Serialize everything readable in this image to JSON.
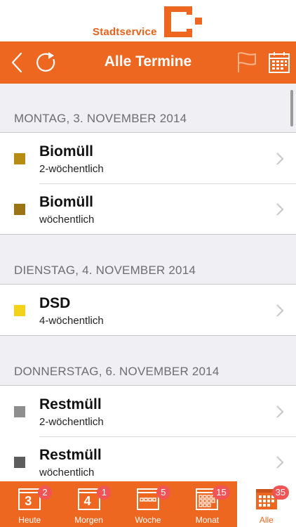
{
  "brand": {
    "name": "Stadtservice"
  },
  "nav": {
    "title": "Alle Termine",
    "icons": [
      "back-icon",
      "refresh-icon",
      "flag-icon",
      "calendar-icon"
    ]
  },
  "sections": [
    {
      "header": "MONTAG, 3. NOVEMBER 2014",
      "items": [
        {
          "title": "Biomüll",
          "subtitle": "2-wöchentlich",
          "color": "#b88c12"
        },
        {
          "title": "Biomüll",
          "subtitle": "wöchentlich",
          "color": "#9b7416"
        }
      ]
    },
    {
      "header": "DIENSTAG, 4. NOVEMBER 2014",
      "items": [
        {
          "title": "DSD",
          "subtitle": "4-wöchentlich",
          "color": "#f4d21a"
        }
      ]
    },
    {
      "header": "DONNERSTAG, 6. NOVEMBER 2014",
      "items": [
        {
          "title": "Restmüll",
          "subtitle": "2-wöchentlich",
          "color": "#8e8e8e"
        },
        {
          "title": "Restmüll",
          "subtitle": "wöchentlich",
          "color": "#5d5d5d"
        }
      ]
    }
  ],
  "tabs": [
    {
      "label": "Heute",
      "icon_number": "3",
      "badge": "2"
    },
    {
      "label": "Morgen",
      "icon_number": "4",
      "badge": "1"
    },
    {
      "label": "Woche",
      "badge": "5"
    },
    {
      "label": "Monat",
      "badge": "15"
    },
    {
      "label": "Alle",
      "badge": "35",
      "active": true
    }
  ],
  "colors": {
    "accent": "#ed6721",
    "badge": "#f05454",
    "background": "#efeff4"
  }
}
